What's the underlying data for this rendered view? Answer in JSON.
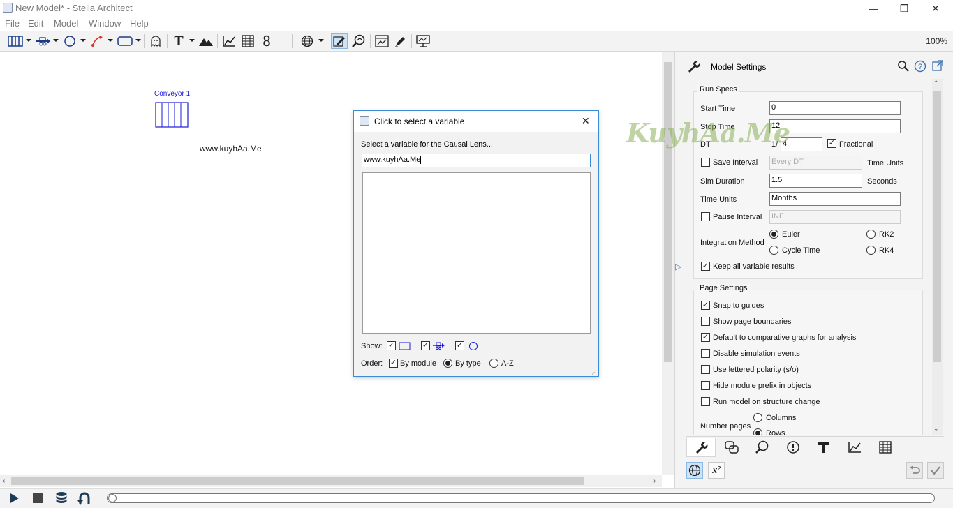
{
  "window": {
    "title": "New Model* - Stella Architect",
    "minimize": "—",
    "restore": "❒",
    "close": "✕"
  },
  "menu": [
    "File",
    "Edit",
    "Model",
    "Window",
    "Help"
  ],
  "toolbar": {
    "zoom": "100%",
    "text_tool": "T",
    "numeric_display": "8",
    "tools": [
      "stock-tool",
      "flow-tool",
      "converter-tool",
      "connector-tool",
      "module-tool",
      "ghost-tool",
      "text-tool",
      "image-tool",
      "graph-tool",
      "table-tool",
      "numeric-display-tool",
      "globe-tool",
      "edit-mode-tool",
      "causal-lens-tool",
      "dashboard-tool",
      "pen-tool",
      "presentation-tool"
    ],
    "colors": {
      "accent": "#1a3a8a",
      "selected_bg": "#cfe3f7"
    }
  },
  "canvas": {
    "conveyor_label": "Conveyor 1",
    "watermark_text": "www.kuyhAa.Me",
    "overlay_logo_text": "KuyhAa.Me"
  },
  "dialog": {
    "title": "Click to select a variable",
    "prompt": "Select a variable for the Causal Lens...",
    "search_value": "www.kuyhAa.Me",
    "show_label": "Show:",
    "show": [
      {
        "name": "stocks",
        "checked": true
      },
      {
        "name": "flows",
        "checked": true
      },
      {
        "name": "converters",
        "checked": true
      }
    ],
    "order_label": "Order:",
    "by_module_label": "By module",
    "by_module_checked": true,
    "order_options": [
      {
        "label": "By type",
        "selected": true
      },
      {
        "label": "A-Z",
        "selected": false
      }
    ],
    "close": "✕"
  },
  "panel": {
    "title": "Model Settings",
    "run_specs": {
      "title": "Run Specs",
      "start_time_label": "Start Time",
      "start_time": "0",
      "stop_time_label": "Stop Time",
      "stop_time": "12",
      "dt_label": "DT",
      "dt_prefix": "1/",
      "dt": "4",
      "fractional_label": "Fractional",
      "fractional_checked": true,
      "save_interval_label": "Save Interval",
      "save_interval": "Every DT",
      "save_interval_units": "Time Units",
      "sim_duration_label": "Sim Duration",
      "sim_duration": "1.5",
      "sim_duration_units": "Seconds",
      "time_units_label": "Time Units",
      "time_units": "Months",
      "pause_interval_label": "Pause Interval",
      "pause_interval": "INF",
      "integration_label": "Integration Method",
      "methods": [
        {
          "label": "Euler",
          "selected": true
        },
        {
          "label": "RK2",
          "selected": false
        },
        {
          "label": "Cycle Time",
          "selected": false
        },
        {
          "label": "RK4",
          "selected": false
        }
      ],
      "keep_results_label": "Keep all variable results",
      "keep_results_checked": true
    },
    "page_settings": {
      "title": "Page Settings",
      "options": [
        {
          "label": "Snap to guides",
          "checked": true
        },
        {
          "label": "Show page boundaries",
          "checked": false
        },
        {
          "label": "Default to comparative graphs for analysis",
          "checked": true
        },
        {
          "label": "Disable simulation events",
          "checked": false
        },
        {
          "label": "Use lettered polarity (s/o)",
          "checked": false
        },
        {
          "label": "Hide module prefix in objects",
          "checked": false
        },
        {
          "label": "Run model on structure change",
          "checked": false
        }
      ],
      "number_pages_label": "Number pages",
      "number_pages_options": [
        {
          "label": "Columns",
          "selected": false
        },
        {
          "label": "Rows",
          "selected": true
        }
      ]
    },
    "tabs": [
      "model-settings",
      "model-structure",
      "causal-lens",
      "warnings",
      "style",
      "graph",
      "table"
    ],
    "superscript_label": "x²"
  }
}
